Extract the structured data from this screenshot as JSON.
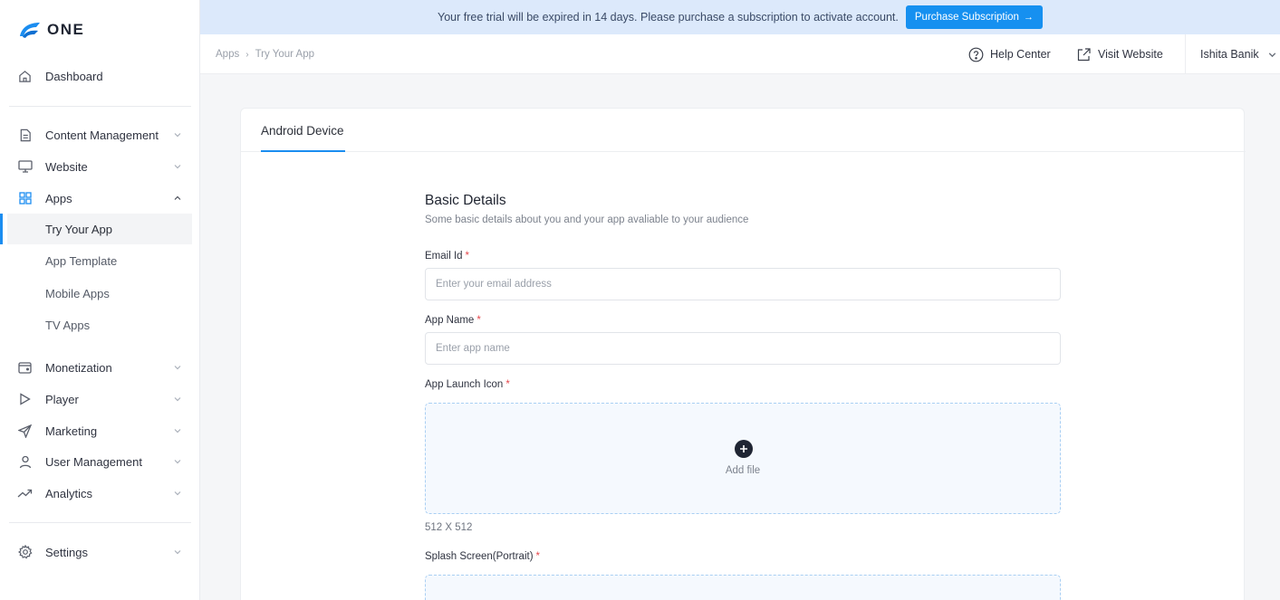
{
  "brand": {
    "name": "ONE",
    "accent": "#1b8df0"
  },
  "banner": {
    "message": "Your free trial will be expired in 14 days. Please purchase a subscription to activate account.",
    "button_label": "Purchase Subscription"
  },
  "breadcrumb": {
    "items": [
      "Apps",
      "Try Your App"
    ]
  },
  "header": {
    "help_label": "Help Center",
    "visit_label": "Visit Website",
    "user_name": "Ishita Banik"
  },
  "sidebar": {
    "dashboard": "Dashboard",
    "content_management": "Content Management",
    "website": "Website",
    "apps": "Apps",
    "apps_children": [
      "Try Your App",
      "App Template",
      "Mobile Apps",
      "TV Apps"
    ],
    "monetization": "Monetization",
    "player": "Player",
    "marketing": "Marketing",
    "user_management": "User Management",
    "analytics": "Analytics",
    "settings": "Settings"
  },
  "tabs": {
    "android": "Android Device"
  },
  "form": {
    "title": "Basic Details",
    "subtitle": "Some basic details about you and your app avaliable to your audience",
    "required_mark": "*",
    "email": {
      "label": "Email Id",
      "placeholder": "Enter your email address"
    },
    "app_name": {
      "label": "App Name",
      "placeholder": "Enter app name"
    },
    "launch_icon": {
      "label": "App Launch Icon",
      "add_label": "Add file",
      "size_hint": "512 X 512"
    },
    "splash_portrait": {
      "label": "Splash Screen(Portrait)"
    }
  }
}
